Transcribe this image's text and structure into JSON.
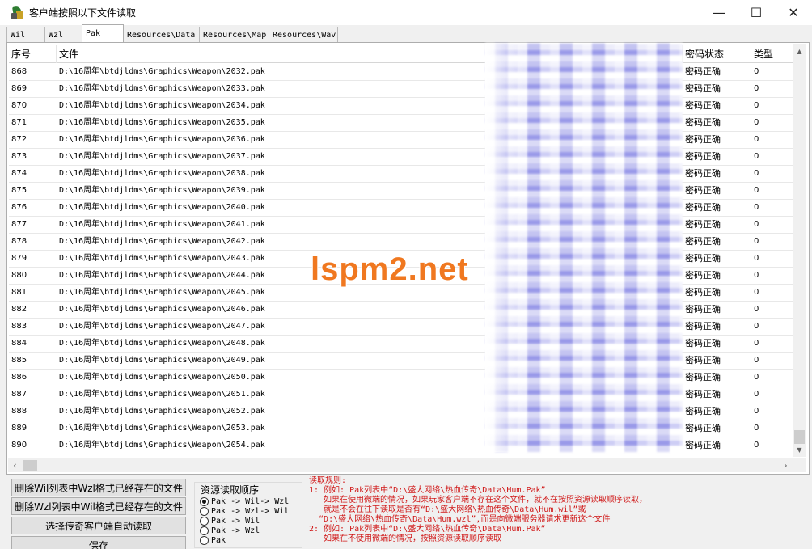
{
  "window": {
    "title": "客户端按照以下文件读取",
    "minimize": "—",
    "maximize": "☐",
    "close": "✕"
  },
  "tabs": [
    {
      "label": "Wil"
    },
    {
      "label": "Wzl"
    },
    {
      "label": "Pak",
      "active": true
    },
    {
      "label": "Resources\\Data"
    },
    {
      "label": "Resources\\Map"
    },
    {
      "label": "Resources\\Wav"
    }
  ],
  "table": {
    "columns": [
      "序号",
      "文件",
      "密码状态",
      "类型"
    ],
    "rows": [
      {
        "idx": "868",
        "file": "D:\\16周年\\btdjldms\\Graphics\\Weapon\\2032.pak",
        "status": "密码正确",
        "type": "0"
      },
      {
        "idx": "869",
        "file": "D:\\16周年\\btdjldms\\Graphics\\Weapon\\2033.pak",
        "status": "密码正确",
        "type": "0"
      },
      {
        "idx": "870",
        "file": "D:\\16周年\\btdjldms\\Graphics\\Weapon\\2034.pak",
        "status": "密码正确",
        "type": "0"
      },
      {
        "idx": "871",
        "file": "D:\\16周年\\btdjldms\\Graphics\\Weapon\\2035.pak",
        "status": "密码正确",
        "type": "0"
      },
      {
        "idx": "872",
        "file": "D:\\16周年\\btdjldms\\Graphics\\Weapon\\2036.pak",
        "status": "密码正确",
        "type": "0"
      },
      {
        "idx": "873",
        "file": "D:\\16周年\\btdjldms\\Graphics\\Weapon\\2037.pak",
        "status": "密码正确",
        "type": "0"
      },
      {
        "idx": "874",
        "file": "D:\\16周年\\btdjldms\\Graphics\\Weapon\\2038.pak",
        "status": "密码正确",
        "type": "0"
      },
      {
        "idx": "875",
        "file": "D:\\16周年\\btdjldms\\Graphics\\Weapon\\2039.pak",
        "status": "密码正确",
        "type": "0"
      },
      {
        "idx": "876",
        "file": "D:\\16周年\\btdjldms\\Graphics\\Weapon\\2040.pak",
        "status": "密码正确",
        "type": "0"
      },
      {
        "idx": "877",
        "file": "D:\\16周年\\btdjldms\\Graphics\\Weapon\\2041.pak",
        "status": "密码正确",
        "type": "0"
      },
      {
        "idx": "878",
        "file": "D:\\16周年\\btdjldms\\Graphics\\Weapon\\2042.pak",
        "status": "密码正确",
        "type": "0"
      },
      {
        "idx": "879",
        "file": "D:\\16周年\\btdjldms\\Graphics\\Weapon\\2043.pak",
        "status": "密码正确",
        "type": "0"
      },
      {
        "idx": "880",
        "file": "D:\\16周年\\btdjldms\\Graphics\\Weapon\\2044.pak",
        "status": "密码正确",
        "type": "0"
      },
      {
        "idx": "881",
        "file": "D:\\16周年\\btdjldms\\Graphics\\Weapon\\2045.pak",
        "status": "密码正确",
        "type": "0"
      },
      {
        "idx": "882",
        "file": "D:\\16周年\\btdjldms\\Graphics\\Weapon\\2046.pak",
        "status": "密码正确",
        "type": "0"
      },
      {
        "idx": "883",
        "file": "D:\\16周年\\btdjldms\\Graphics\\Weapon\\2047.pak",
        "status": "密码正确",
        "type": "0"
      },
      {
        "idx": "884",
        "file": "D:\\16周年\\btdjldms\\Graphics\\Weapon\\2048.pak",
        "status": "密码正确",
        "type": "0"
      },
      {
        "idx": "885",
        "file": "D:\\16周年\\btdjldms\\Graphics\\Weapon\\2049.pak",
        "status": "密码正确",
        "type": "0"
      },
      {
        "idx": "886",
        "file": "D:\\16周年\\btdjldms\\Graphics\\Weapon\\2050.pak",
        "status": "密码正确",
        "type": "0"
      },
      {
        "idx": "887",
        "file": "D:\\16周年\\btdjldms\\Graphics\\Weapon\\2051.pak",
        "status": "密码正确",
        "type": "0"
      },
      {
        "idx": "888",
        "file": "D:\\16周年\\btdjldms\\Graphics\\Weapon\\2052.pak",
        "status": "密码正确",
        "type": "0"
      },
      {
        "idx": "889",
        "file": "D:\\16周年\\btdjldms\\Graphics\\Weapon\\2053.pak",
        "status": "密码正确",
        "type": "0"
      },
      {
        "idx": "890",
        "file": "D:\\16周年\\btdjldms\\Graphics\\Weapon\\2054.pak",
        "status": "密码正确",
        "type": "0"
      }
    ]
  },
  "watermark": "lspm2.net",
  "buttons": {
    "delete_wil": "删除Wil列表中Wzl格式已经存在的文件",
    "delete_wzl": "删除Wzl列表中Wil格式已经存在的文件",
    "auto_read": "选择传奇客户端自动读取",
    "save": "保存"
  },
  "resource_order": {
    "title": "资源读取顺序",
    "options": [
      {
        "label": "Pak -> Wil-> Wzl",
        "checked": true
      },
      {
        "label": "Pak -> Wzl-> Wil",
        "checked": false
      },
      {
        "label": "Pak -> Wil",
        "checked": false
      },
      {
        "label": "Pak -> Wzl",
        "checked": false
      },
      {
        "label": "Pak",
        "checked": false
      }
    ]
  },
  "rules": [
    "读取规则:",
    "1: 例如: Pak列表中“D:\\盛大网络\\热血传奇\\Data\\Hum.Pak”",
    "   如果在使用微端的情况，如果玩家客户端不存在这个文件，就不在按照资源读取顺序读取，",
    "   就是不会在往下读取是否有“D:\\盛大网络\\热血传奇\\Data\\Hum.wil”或",
    "  “D:\\盛大网络\\热血传奇\\Data\\Hum.wzl”,而是向微端服务器请求更新这个文件",
    "2: 例如: Pak列表中“D:\\盛大网络\\热血传奇\\Data\\Hum.Pak”",
    "   如果在不使用微端的情况，按照资源读取顺序读取"
  ],
  "colors": {
    "rules_text": "#d01818",
    "watermark": "#f07820"
  }
}
